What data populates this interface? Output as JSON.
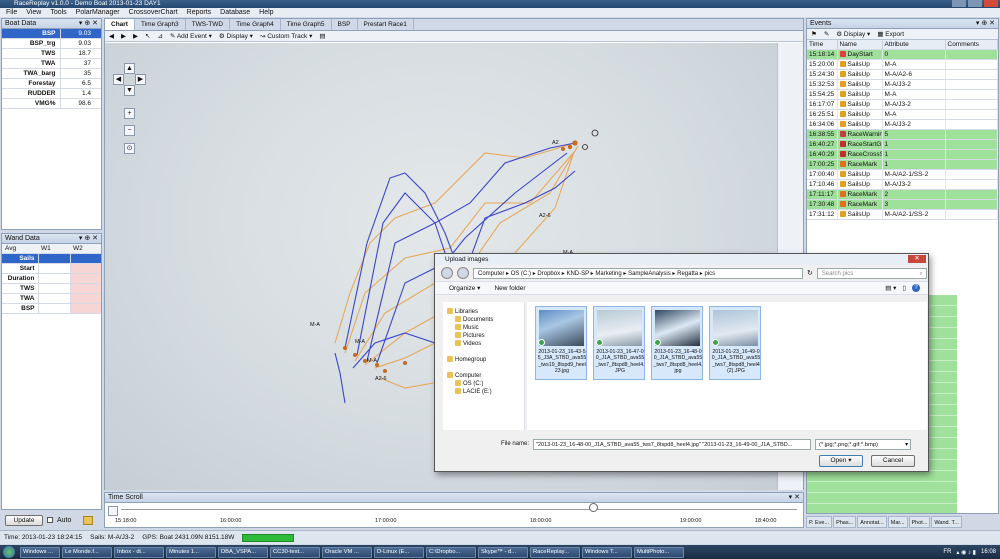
{
  "window": {
    "title": "RaceReplay v1.0.0 - Demo Boat 2013-01-23 DAY1"
  },
  "menu": [
    "File",
    "View",
    "Tools",
    "PolarManager",
    "CrossoverChart",
    "Reports",
    "Database",
    "Help"
  ],
  "boat_data": {
    "title": "Boat Data",
    "rows": [
      {
        "label": "BSP",
        "value": "9.03"
      },
      {
        "label": "BSP_trg",
        "value": "9.03"
      },
      {
        "label": "TWS",
        "value": "18.7"
      },
      {
        "label": "TWA",
        "value": "37"
      },
      {
        "label": "TWA_barg",
        "value": "35"
      },
      {
        "label": "Forestay",
        "value": "6.5"
      },
      {
        "label": "RUDDER",
        "value": "1.4"
      },
      {
        "label": "VMG%",
        "value": "98.6"
      }
    ]
  },
  "wand_data": {
    "title": "Wand Data",
    "cols": [
      "Avg",
      "W1",
      "W2"
    ],
    "rows": [
      "Sails",
      "Start",
      "Duration",
      "TWS",
      "TWA",
      "BSP"
    ]
  },
  "left_bottom": {
    "update": "Update",
    "auto": "Auto"
  },
  "tabs": [
    "Chart",
    "Time Graph3",
    "TWS-TWD",
    "Time Graph4",
    "Time Graph5",
    "BSP",
    "Prestart Race1"
  ],
  "toolbar": {
    "add_event": "Add Event",
    "display": "Display",
    "custom_track": "Custom Track"
  },
  "map_labels": [
    "A2",
    "A2-6",
    "M-A",
    "M-A",
    "M-A",
    "M-A",
    "A2-6"
  ],
  "events": {
    "title": "Events",
    "toolbar_display": "Display",
    "toolbar_export": "Export",
    "headers": [
      "Time",
      "Name",
      "Attribute",
      "Comments"
    ],
    "rows": [
      {
        "time": "15:18:14",
        "name": "DayStart",
        "attr": "0",
        "green": true
      },
      {
        "time": "15:20:00",
        "name": "SailsUp",
        "attr": "M-A",
        "green": false
      },
      {
        "time": "15:24:30",
        "name": "SailsUp",
        "attr": "M-A/A2-6",
        "green": false
      },
      {
        "time": "15:32:53",
        "name": "SailsUp",
        "attr": "M-A/J3-2",
        "green": false
      },
      {
        "time": "15:54:25",
        "name": "SailsUp",
        "attr": "M-A",
        "green": false
      },
      {
        "time": "16:17:07",
        "name": "SailsUp",
        "attr": "M-A/J3-2",
        "green": false
      },
      {
        "time": "16:25:51",
        "name": "SailsUp",
        "attr": "M-A",
        "green": false
      },
      {
        "time": "16:34:06",
        "name": "SailsUp",
        "attr": "M-A/J3-2",
        "green": false
      },
      {
        "time": "16:38:55",
        "name": "RaceWarningS",
        "attr": "5",
        "green": true
      },
      {
        "time": "16:40:27",
        "name": "RaceStartGun",
        "attr": "1",
        "green": true
      },
      {
        "time": "16:40:29",
        "name": "RaceCrossStar",
        "attr": "1",
        "green": true
      },
      {
        "time": "17:00:25",
        "name": "RaceMark",
        "attr": "1",
        "green": true
      },
      {
        "time": "17:00:40",
        "name": "SailsUp",
        "attr": "M-A/A2-1/SS-2",
        "green": false
      },
      {
        "time": "17:10:46",
        "name": "SailsUp",
        "attr": "M-A/J3-2",
        "green": false
      },
      {
        "time": "17:11:17",
        "name": "RaceMark",
        "attr": "2",
        "green": true
      },
      {
        "time": "17:30:48",
        "name": "RaceMark",
        "attr": "3",
        "green": true
      },
      {
        "time": "17:31:12",
        "name": "SailsUp",
        "attr": "M-A/A2-1/SS-2",
        "green": false
      }
    ]
  },
  "right_bottom_tabs": [
    "P. Eve...",
    "Phas...",
    "Annotat...",
    "Mar...",
    "Phot...",
    "Wand. T..."
  ],
  "time_scroll": {
    "title": "Time Scroll",
    "ticks": [
      "15:18:00",
      "16:00:00",
      "17:00:00",
      "18:00:00",
      "19:00:00",
      "18:40:00"
    ]
  },
  "status": {
    "time": "Time: 2013-01-23 18:24:15",
    "sails": "Sails: M-A/J3-2",
    "gps": "GPS: Boat 2431.09N 8151.18W"
  },
  "dialog": {
    "title": "Upload images",
    "path": [
      "Computer",
      "OS (C:)",
      "Dropbox",
      "KND-SP",
      "Marketing",
      "SampleAnalysis",
      "Regatta",
      "pics"
    ],
    "search_placeholder": "Search pics",
    "organize": "Organize",
    "new_folder": "New folder",
    "nav": [
      {
        "label": "Libraries",
        "indent": 0
      },
      {
        "label": "Documents",
        "indent": 1
      },
      {
        "label": "Music",
        "indent": 1
      },
      {
        "label": "Pictures",
        "indent": 1
      },
      {
        "label": "Videos",
        "indent": 1
      },
      {
        "label": "",
        "indent": 0
      },
      {
        "label": "Homegroup",
        "indent": 0
      },
      {
        "label": "",
        "indent": 0
      },
      {
        "label": "Computer",
        "indent": 0
      },
      {
        "label": "OS (C:)",
        "indent": 1
      },
      {
        "label": "LACIE (E:)",
        "indent": 1
      }
    ],
    "files": [
      "2013-01-23_16-43-55_J3A_STBD_ava55_tws19_8tspd9_heel23.jpg",
      "2013-01-23_16-47-00_J1A_STBD_ava55_tws7_8tspd8_heel4.JPG",
      "2013-01-23_16-48-00_J1A_STBD_ava55_tws7_8tspd8_heel4.jpg",
      "2013-01-23_16-49-00_J1A_STBD_ava55_tws7_8tspd8_heel4 (2).JPG"
    ],
    "file_name_label": "File name:",
    "file_name_value": "\"2013-01-23_16-48-00_J1A_STBD_ava55_tws7_8tspd8_heel4.jpg\" \"2013-01-23_16-49-00_J1A_STBD...",
    "filter": "(*.jpg;*.png;*.gif;*.bmp)",
    "open": "Open",
    "cancel": "Cancel"
  },
  "taskbar": {
    "items": [
      "Windows ...",
      "Le Monde.f...",
      "Inbox - di...",
      "Minutes 1...",
      "DBA_VSPA...",
      "CC30-test...",
      "Oracle VM ...",
      "D-Linux (E...",
      "C:\\Dropbo...",
      "Skype™ - d...",
      "RaceReplay...",
      "Windows T...",
      "MultiPhoto..."
    ],
    "lang": "FR",
    "clock": "16:08"
  },
  "colors": {
    "track_blue": "#2a35c8",
    "track_orange": "#e8a24a",
    "event_green": "#9fe09a",
    "selection": "#2f66c8"
  }
}
